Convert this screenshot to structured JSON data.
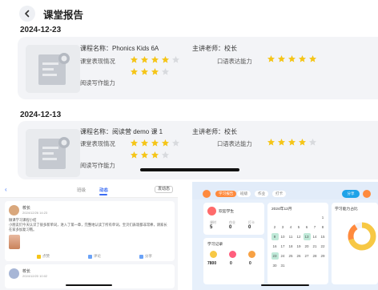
{
  "header": {
    "title": "课堂报告"
  },
  "reports": [
    {
      "date": "2024-12-23",
      "course": "课程名称：Phonics Kids 6A",
      "teacher": "主讲老师：校长",
      "performance_label": "课堂表现情况",
      "performance_stars": 7,
      "oral_label": "口语表达能力",
      "oral_stars": 5,
      "reading_label": "阅读写作能力"
    },
    {
      "date": "2024-12-13",
      "course": "课程名称：阅读营 demo 课 1",
      "teacher": "主讲老师：校长",
      "performance_label": "课堂表现情况",
      "performance_stars": 7,
      "oral_label": "口语表达能力",
      "oral_stars": 4,
      "reading_label": "阅读写作能力"
    }
  ],
  "colors": {
    "star_on": "#f5c518",
    "star_off": "#d8dade",
    "accent_orange": "#ff8a3d",
    "accent_blue": "#3b6cf3"
  },
  "feed": {
    "tabs": [
      "班级",
      "动态"
    ],
    "active_tab": "动态",
    "action_button": "发动态",
    "posts": [
      {
        "name": "校长",
        "time": "2024/12/26 14:23",
        "text": "微课学习课程小结",
        "body": "小朋友们今天认识了很多新单词，进入了第一章，完整地认读了所有单词，宝贝们表现都非常棒，请家长在家多加复习哦。",
        "likes": "点赞",
        "comments": "评论",
        "share": "分享"
      },
      {
        "name": "校长",
        "time": "2024/12/20 10:02"
      }
    ]
  },
  "dashboard": {
    "tabs": [
      "学习报告",
      "班级",
      "作业",
      "打卡"
    ],
    "active_tab": "学习报告",
    "pill": "分享",
    "profile_name": "欢迎学生",
    "stats": [
      {
        "label": "课时",
        "value": "5"
      },
      {
        "label": "作业",
        "value": "0"
      },
      {
        "label": "打卡",
        "value": "0"
      }
    ],
    "learning_label": "学习记录",
    "bottom_stats": [
      "7800",
      "0",
      "0"
    ],
    "calendar_title": "2024年12月",
    "calendar_days": [
      "1",
      "2",
      "3",
      "4",
      "5",
      "6",
      "7",
      "8",
      "9",
      "10",
      "11",
      "12",
      "13",
      "14",
      "15",
      "16",
      "17",
      "18",
      "19",
      "20",
      "21",
      "22",
      "23",
      "24",
      "25",
      "26",
      "27",
      "28",
      "29",
      "30",
      "31"
    ],
    "highlight_days": [
      "9",
      "13",
      "23"
    ],
    "chart_title": "学习能力占比"
  }
}
